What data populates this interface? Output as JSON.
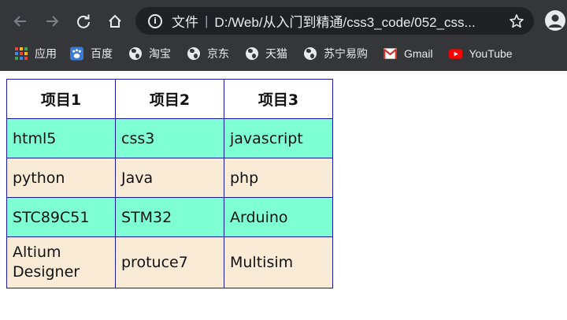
{
  "browser": {
    "security_label": "文件",
    "separator": "|",
    "url": "D:/Web/从入门到精通/css3_code/052_css...",
    "bookmarks": [
      {
        "label": "应用",
        "icon": "apps-grid-icon"
      },
      {
        "label": "百度",
        "icon": "baidu-icon"
      },
      {
        "label": "淘宝",
        "icon": "globe-icon"
      },
      {
        "label": "京东",
        "icon": "globe-icon"
      },
      {
        "label": "天猫",
        "icon": "globe-icon"
      },
      {
        "label": "苏宁易购",
        "icon": "globe-icon"
      },
      {
        "label": "Gmail",
        "icon": "gmail-icon"
      },
      {
        "label": "YouTube",
        "icon": "youtube-icon"
      }
    ],
    "colors": {
      "chrome_bg": "#35363a",
      "omnibox_bg": "#202124",
      "text": "#e8eaed"
    }
  },
  "table": {
    "headers": [
      "项目1",
      "项目2",
      "项目3"
    ],
    "rows": [
      [
        "html5",
        "css3",
        "javascript"
      ],
      [
        "python",
        "Java",
        "php"
      ],
      [
        "STC89C51",
        "STM32",
        "Arduino"
      ],
      [
        "Altium Designer",
        "protuce7",
        "Multisim"
      ]
    ],
    "colors": {
      "odd_row": "#7fffd4",
      "even_row": "#faebd7",
      "border": "#1a1aa0"
    }
  }
}
